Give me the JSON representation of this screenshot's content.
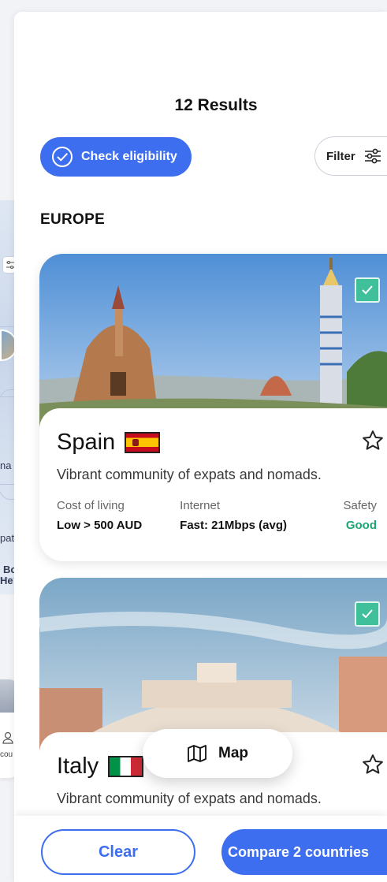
{
  "header": {
    "results_title": "12 Results"
  },
  "actions": {
    "eligibility_label": "Check eligibility",
    "filter_label": "Filter"
  },
  "region": {
    "title": "EUROPE"
  },
  "destinations": [
    {
      "country": "Spain",
      "flag": "spain-flag",
      "description": "Vibrant community of expats and nomads.",
      "selected": true,
      "stats": {
        "cost_label": "Cost of living",
        "cost_value": "Low > 500 AUD",
        "internet_label": "Internet",
        "internet_value": "Fast: 21Mbps (avg)",
        "safety_label": "Safety",
        "safety_value": "Good"
      }
    },
    {
      "country": "Italy",
      "flag": "italy-flag",
      "description": "Vibrant community of expats and nomads.",
      "selected": true
    }
  ],
  "map_button": {
    "label": "Map"
  },
  "bottom_bar": {
    "clear_label": "Clear",
    "compare_label": "Compare 2 countries"
  },
  "background_fragments": [
    "na",
    "pat",
    "Bo",
    "He",
    "cou"
  ],
  "colors": {
    "primary": "#3d6ef0",
    "check": "#3fbf9a",
    "safety_good": "#1ea672"
  }
}
